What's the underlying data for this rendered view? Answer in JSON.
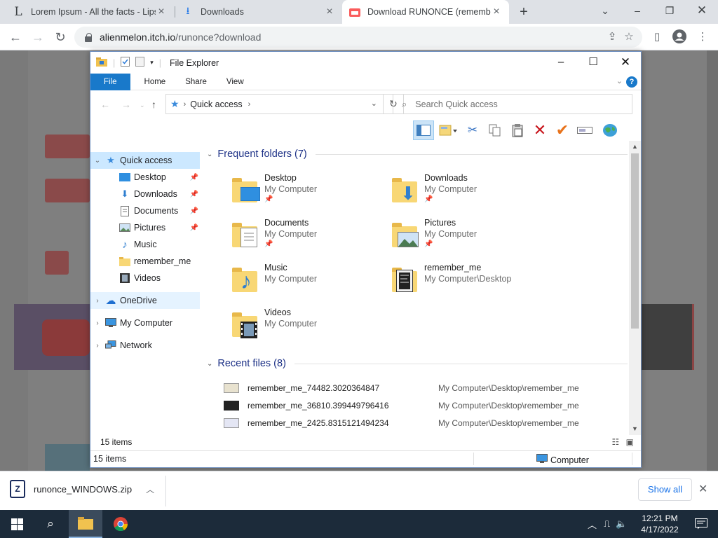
{
  "browser": {
    "tabs": [
      {
        "label": "Lorem Ipsum - All the facts - Lipsum",
        "favicon": "L"
      },
      {
        "label": "Downloads",
        "favicon": "download-icon"
      },
      {
        "label": "Download RUNONCE (remember_me)",
        "favicon": "itch-icon"
      }
    ],
    "url_host": "alienmelon.itch.io",
    "url_path": "/runonce?download"
  },
  "explorer": {
    "title": "File Explorer",
    "ribbon_tabs": [
      "File",
      "Home",
      "Share",
      "View"
    ],
    "address": "Quick access",
    "search_placeholder": "Search Quick access",
    "nav": {
      "quick_access": "Quick access",
      "items": [
        {
          "label": "Desktop",
          "pinned": true
        },
        {
          "label": "Downloads",
          "pinned": true
        },
        {
          "label": "Documents",
          "pinned": true
        },
        {
          "label": "Pictures",
          "pinned": true
        },
        {
          "label": "Music",
          "pinned": false
        },
        {
          "label": "remember_me",
          "pinned": false
        },
        {
          "label": "Videos",
          "pinned": false
        }
      ],
      "onedrive": "OneDrive",
      "my_computer": "My Computer",
      "network": "Network"
    },
    "frequent_header": "Frequent folders (7)",
    "frequent": [
      {
        "name": "Desktop",
        "loc": "My Computer"
      },
      {
        "name": "Downloads",
        "loc": "My Computer"
      },
      {
        "name": "Documents",
        "loc": "My Computer"
      },
      {
        "name": "Pictures",
        "loc": "My Computer"
      },
      {
        "name": "Music",
        "loc": "My Computer"
      },
      {
        "name": "remember_me",
        "loc": "My Computer\\Desktop"
      },
      {
        "name": "Videos",
        "loc": "My Computer"
      }
    ],
    "recent_header": "Recent files (8)",
    "recent": [
      {
        "name": "remember_me_74482.3020364847",
        "loc": "My Computer\\Desktop\\remember_me"
      },
      {
        "name": "remember_me_36810.399449796416",
        "loc": "My Computer\\Desktop\\remember_me"
      },
      {
        "name": "remember_me_2425.8315121494234",
        "loc": "My Computer\\Desktop\\remember_me"
      }
    ],
    "item_count": "15 items",
    "status_count": "15 items",
    "status_location": "Computer"
  },
  "downloads_shelf": {
    "file": "runonce_WINDOWS.zip",
    "show_all": "Show all"
  },
  "taskbar": {
    "time": "12:21 PM",
    "date": "4/17/2022"
  }
}
